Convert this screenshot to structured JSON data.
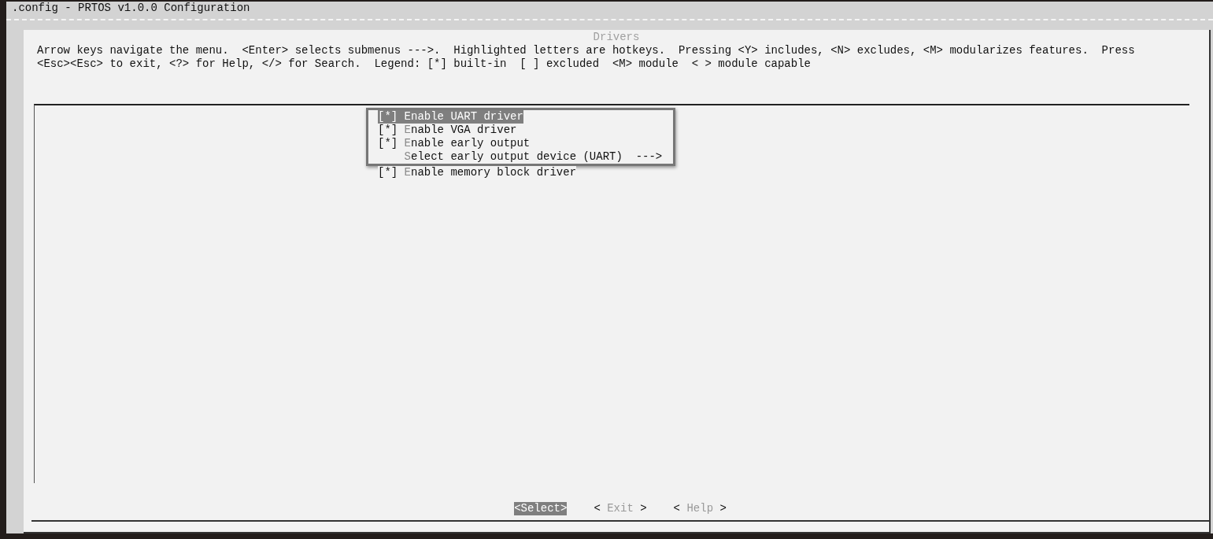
{
  "window": {
    "title": ".config - PRTOS v1.0.0 Configuration"
  },
  "dialog": {
    "title": "Drivers",
    "help_lines": [
      "Arrow keys navigate the menu.  <Enter> selects submenus --->.  Highlighted letters are hotkeys.  Pressing <Y> includes, <N> excludes, <M> modularizes features.  Press",
      "<Esc><Esc> to exit, <?> for Help, </> for Search.  Legend: [*] built-in  [ ] excluded  <M> module  < > module capable"
    ],
    "items": [
      {
        "kind": "bool",
        "prefix": "[*]",
        "label": "Enable UART driver",
        "selected": true
      },
      {
        "kind": "bool",
        "prefix": "[*]",
        "label": "Enable VGA driver",
        "selected": false
      },
      {
        "kind": "bool",
        "prefix": "[*]",
        "label": "Enable early output",
        "selected": false
      },
      {
        "kind": "menu",
        "label": "Select early output device (UART)",
        "suffix": "--->",
        "selected": false
      },
      {
        "kind": "bool",
        "prefix": "[*]",
        "label": "Enable memory block driver",
        "selected": false
      }
    ],
    "buttons": [
      {
        "open": "<",
        "label": "Select",
        "close": ">",
        "selected": true
      },
      {
        "open": "< ",
        "label": "Exit",
        "close": " >",
        "selected": false
      },
      {
        "open": "< ",
        "label": "Help",
        "close": " >",
        "selected": false
      }
    ]
  }
}
